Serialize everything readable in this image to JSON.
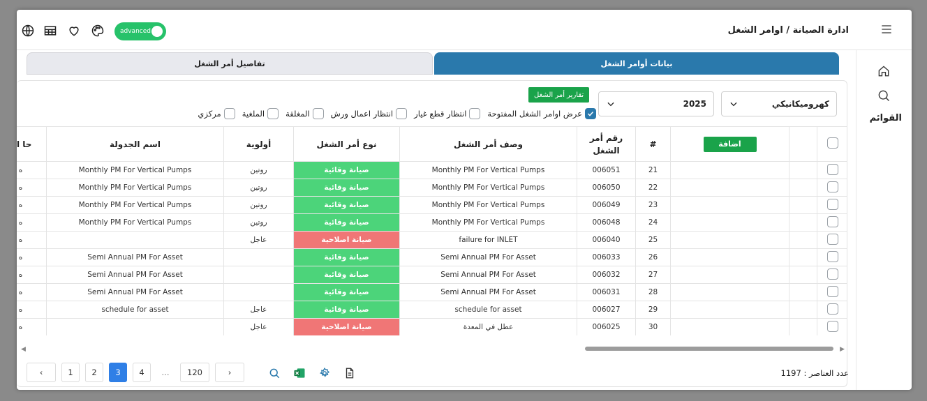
{
  "header": {
    "title": "ادارة الصيانة / اوامر الشغل",
    "mode_toggle": "advanced"
  },
  "rail": {
    "lists_label": "القوائم"
  },
  "tabs": [
    {
      "label": "بيانات أوامر الشغل",
      "active": true
    },
    {
      "label": "تفاصيل أمر الشغل",
      "active": false
    }
  ],
  "filters": {
    "department": "كهروميكانيكي",
    "year": "2025",
    "report_button": "تقارير أمر الشغل",
    "checkboxes": [
      {
        "label": "عرض اوامر الشغل المفتوحة",
        "checked": true
      },
      {
        "label": "انتظار قطع غيار",
        "checked": false
      },
      {
        "label": "انتظار اعمال ورش",
        "checked": false
      },
      {
        "label": "المغلقة",
        "checked": false
      },
      {
        "label": "الملغية",
        "checked": false
      },
      {
        "label": "مركزي",
        "checked": false
      }
    ]
  },
  "table": {
    "add_button": "اضافة",
    "headers": [
      "#",
      "رقم أمر الشغل",
      "وصف أمر الشغل",
      "نوع أمر الشغل",
      "أولوية",
      "اسم الجدولة",
      "حا ال"
    ],
    "rows": [
      {
        "num": "21",
        "wo": "006051",
        "desc": "Monthly PM For Vertical Pumps",
        "type": "صيانة وقائية",
        "priority": "روتين",
        "schedule": "Monthly PM For Vertical Pumps",
        "status": "ه"
      },
      {
        "num": "22",
        "wo": "006050",
        "desc": "Monthly PM For Vertical Pumps",
        "type": "صيانة وقائية",
        "priority": "روتين",
        "schedule": "Monthly PM For Vertical Pumps",
        "status": "ه"
      },
      {
        "num": "23",
        "wo": "006049",
        "desc": "Monthly PM For Vertical Pumps",
        "type": "صيانة وقائية",
        "priority": "روتين",
        "schedule": "Monthly PM For Vertical Pumps",
        "status": "ه"
      },
      {
        "num": "24",
        "wo": "006048",
        "desc": "Monthly PM For Vertical Pumps",
        "type": "صيانة وقائية",
        "priority": "روتين",
        "schedule": "Monthly PM For Vertical Pumps",
        "status": "ه"
      },
      {
        "num": "25",
        "wo": "006040",
        "desc": "failure for INLET",
        "type": "صيانة اصلاحية",
        "priority": "عاجل",
        "schedule": "",
        "status": "ه"
      },
      {
        "num": "26",
        "wo": "006033",
        "desc": "Semi Annual PM For Asset",
        "type": "صيانة وقائية",
        "priority": "",
        "schedule": "Semi Annual PM For Asset",
        "status": "ه"
      },
      {
        "num": "27",
        "wo": "006032",
        "desc": "Semi Annual PM For Asset",
        "type": "صيانة وقائية",
        "priority": "",
        "schedule": "Semi Annual PM For Asset",
        "status": "ه"
      },
      {
        "num": "28",
        "wo": "006031",
        "desc": "Semi Annual PM For Asset",
        "type": "صيانة وقائية",
        "priority": "",
        "schedule": "Semi Annual PM For Asset",
        "status": "ه"
      },
      {
        "num": "29",
        "wo": "006027",
        "desc": "schedule for asset",
        "type": "صيانة وقائية",
        "priority": "عاجل",
        "schedule": "schedule for asset",
        "status": "ه"
      },
      {
        "num": "30",
        "wo": "006025",
        "desc": "عطل في المعدة",
        "type": "صيانة اصلاحية",
        "priority": "عاجل",
        "schedule": "",
        "status": "ه"
      }
    ]
  },
  "pagination": {
    "prev": "‹",
    "next": "›",
    "pages": [
      "1",
      "2",
      "3",
      "4",
      "...",
      "120"
    ],
    "current": "3"
  },
  "footer": {
    "count_label": "عدد العناصر : 1197"
  },
  "colors": {
    "primary": "#2a79ac",
    "green": "#1aa34a",
    "preventive": "#4cd47a",
    "corrective": "#f07676",
    "page_active": "#2f7fe6"
  }
}
